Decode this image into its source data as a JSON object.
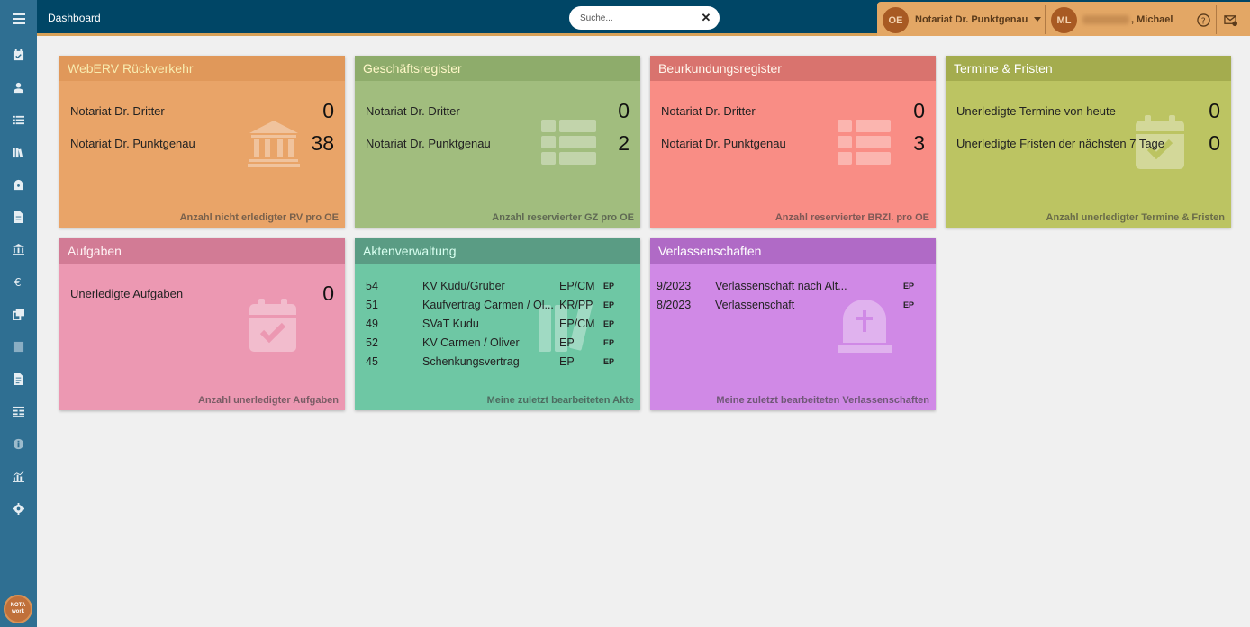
{
  "header": {
    "title": "Dashboard"
  },
  "search": {
    "placeholder": "Suche...",
    "clear": "✕"
  },
  "user_area": {
    "org_initials": "OE",
    "org_name": "Notariat Dr. Punktgenau",
    "user_initials": "ML",
    "user_name": ", Michael"
  },
  "sidebar": {
    "items": [
      "calendar-check-icon",
      "user-icon",
      "list-icon",
      "books-icon",
      "safe-icon",
      "document-icon",
      "bank-icon",
      "euro-icon",
      "copy-icon",
      "square-icon",
      "file-text-icon",
      "accounts-icon",
      "info-icon",
      "chart-icon",
      "gear-icon"
    ],
    "logo_top": "NOTA",
    "logo_bottom": "work"
  },
  "cards": {
    "webERV": {
      "title": "WebERV Rückverkehr",
      "rows": [
        {
          "label": "Notariat Dr. Dritter",
          "value": "0"
        },
        {
          "label": "Notariat Dr. Punktgenau",
          "value": "38"
        }
      ],
      "footer": "Anzahl nicht erledigter RV pro OE",
      "color_head": "#e0985a",
      "color_body": "#e9a468",
      "color_title": "#f8ecb0"
    },
    "gr": {
      "title": "Geschäftsregister",
      "rows": [
        {
          "label": "Notariat Dr. Dritter",
          "value": "0"
        },
        {
          "label": "Notariat Dr. Punktgenau",
          "value": "2"
        }
      ],
      "footer": "Anzahl reservierter GZ pro OE",
      "color_head": "#8eac6b",
      "color_body": "#a1bd7e",
      "color_title": "#fff7c8"
    },
    "br": {
      "title": "Beurkundungsregister",
      "rows": [
        {
          "label": "Notariat Dr. Dritter",
          "value": "0"
        },
        {
          "label": "Notariat Dr. Punktgenau",
          "value": "3"
        }
      ],
      "footer": "Anzahl reservierter BRZl. pro OE",
      "color_head": "#d9736e",
      "color_body": "#f98d85",
      "color_title": "#fff6ec"
    },
    "tf": {
      "title": "Termine & Fristen",
      "rows": [
        {
          "label": "Unerledigte Termine von heute",
          "value": "0"
        },
        {
          "label": "Unerledigte Fristen der nächsten 7 Tage",
          "value": "0"
        }
      ],
      "footer": "Anzahl unerledigter Termine & Fristen",
      "color_head": "#a4ac4e",
      "color_body": "#bcc462",
      "color_title": "#ffffff"
    },
    "aufgaben": {
      "title": "Aufgaben",
      "rows": [
        {
          "label": "Unerledigte Aufgaben",
          "value": "0"
        }
      ],
      "footer": "Anzahl unerledigter Aufgaben",
      "color_head": "#d27b95",
      "color_body": "#ec98b2",
      "color_title": "#fff2f4"
    },
    "akten": {
      "title": "Aktenverwaltung",
      "rows": [
        {
          "nr": "54",
          "name": "KV Kudu/Gruber",
          "kuerzel": "EP/CM",
          "badge": "EP"
        },
        {
          "nr": "51",
          "name": "Kaufvertrag Carmen / Ol...",
          "kuerzel": "KR/PP",
          "badge": "EP"
        },
        {
          "nr": "49",
          "name": "SVaT Kudu",
          "kuerzel": "EP/CM",
          "badge": "EP"
        },
        {
          "nr": "52",
          "name": "KV Carmen / Oliver",
          "kuerzel": "EP",
          "badge": "EP"
        },
        {
          "nr": "45",
          "name": "Schenkungsvertrag",
          "kuerzel": "EP",
          "badge": "EP"
        }
      ],
      "footer": "Meine zuletzt bearbeiteten Akte",
      "color_head": "#5a9c84",
      "color_body": "#6ec7a4",
      "color_title": "#d8fff0"
    },
    "verl": {
      "title": "Verlassenschaften",
      "rows": [
        {
          "nr": "9/2023",
          "name": "Verlassenschaft nach Alt...",
          "badge": "EP"
        },
        {
          "nr": "8/2023",
          "name": "Verlassenschaft",
          "badge": "EP"
        }
      ],
      "footer": "Meine zuletzt bearbeiteten Verlassenschaften",
      "color_head": "#b06ac6",
      "color_body": "#d089e6",
      "color_title": "#ffffff"
    }
  }
}
